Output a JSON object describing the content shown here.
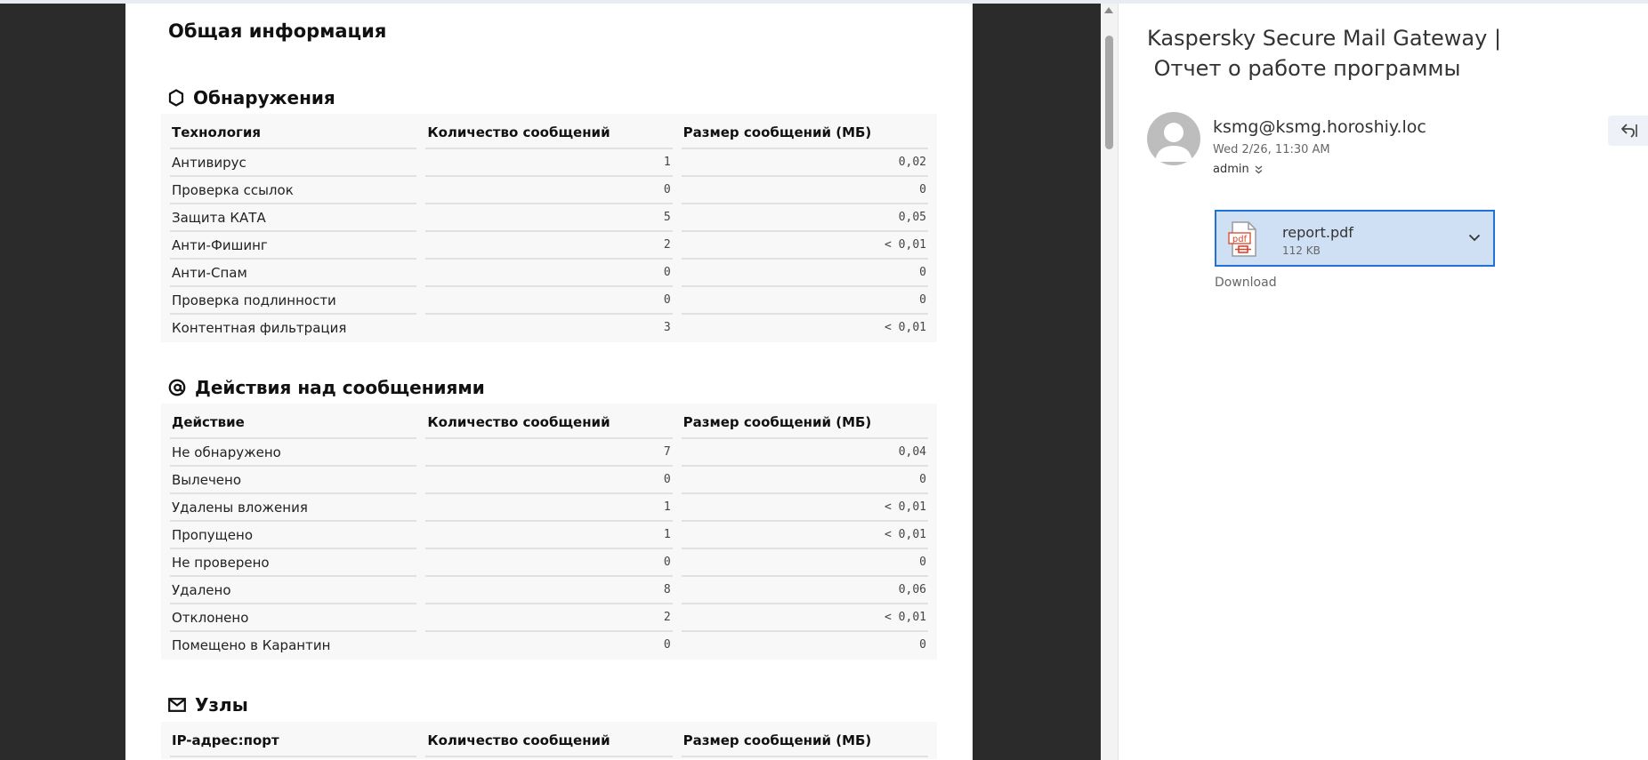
{
  "report": {
    "title": "Общая информация",
    "detections": {
      "title": "Обнаружения",
      "headers": [
        "Технология",
        "Количество сообщений",
        "Размер сообщений (МБ)"
      ],
      "rows": [
        [
          "Антивирус",
          "1",
          "0,02"
        ],
        [
          "Проверка ссылок",
          "0",
          "0"
        ],
        [
          "Защита КАТА",
          "5",
          "0,05"
        ],
        [
          "Анти-Фишинг",
          "2",
          "< 0,01"
        ],
        [
          "Анти-Спам",
          "0",
          "0"
        ],
        [
          "Проверка подлинности",
          "0",
          "0"
        ],
        [
          "Контентная фильтрация",
          "3",
          "< 0,01"
        ]
      ]
    },
    "actions": {
      "title": "Действия над сообщениями",
      "headers": [
        "Действие",
        "Количество сообщений",
        "Размер сообщений (МБ)"
      ],
      "rows": [
        [
          "Не обнаружено",
          "7",
          "0,04"
        ],
        [
          "Вылечено",
          "0",
          "0"
        ],
        [
          "Удалены вложения",
          "1",
          "< 0,01"
        ],
        [
          "Пропущено",
          "1",
          "< 0,01"
        ],
        [
          "Не проверено",
          "0",
          "0"
        ],
        [
          "Удалено",
          "8",
          "0,06"
        ],
        [
          "Отклонено",
          "2",
          "< 0,01"
        ],
        [
          "Помещено в Карантин",
          "0",
          "0"
        ]
      ]
    },
    "nodes": {
      "title": "Узлы",
      "headers": [
        "IP-адрес:порт",
        "Количество сообщений",
        "Размер сообщений (МБ)"
      ]
    }
  },
  "mail": {
    "subject_line1": "Kaspersky Secure Mail Gateway |",
    "subject_line2": " Отчет о работе программы",
    "sender": "ksmg@ksmg.horoshiy.loc",
    "datetime": "Wed 2/26, 11:30 AM",
    "to": "admin",
    "attachment": {
      "name": "report.pdf",
      "size": "112 KB",
      "icon": "pdf-file-icon"
    },
    "download_label": "Download"
  },
  "colors": {
    "dark_background": "#2b2b2b",
    "attachment_bg": "#cfe0f4",
    "attachment_border": "#1f73d6",
    "pdf_red": "#d9452b"
  }
}
